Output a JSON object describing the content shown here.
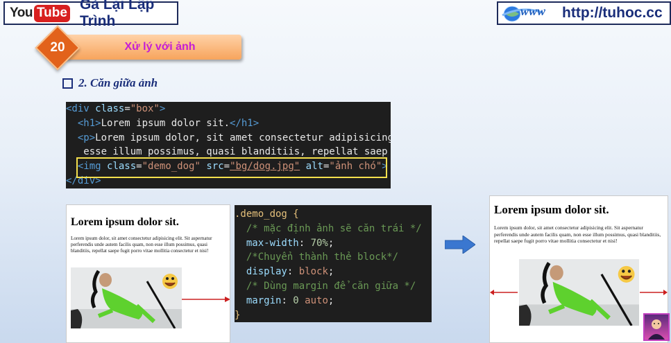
{
  "header": {
    "youtube_logo_you": "You",
    "youtube_logo_tube": "Tube",
    "channel_name": "Gà Lại Lập Trình",
    "globe_logo_text": "www",
    "site_url": "http://tuhoc.cc"
  },
  "lesson": {
    "number": "20",
    "title": "Xử lý với ảnh"
  },
  "section": {
    "heading": "2. Căn giữa ảnh"
  },
  "html_code": {
    "line1": {
      "open": "<div ",
      "attr": "class",
      "eq": "=",
      "val": "\"box\"",
      "close": ">"
    },
    "line2": {
      "indent": "  ",
      "open": "<h1>",
      "text": "Lorem ipsum dolor sit.",
      "close": "</h1>"
    },
    "line3": {
      "indent": "  ",
      "open": "<p>",
      "text": "Lorem ipsum dolor, sit amet consectetur adipisicing"
    },
    "line4": {
      "text": "   esse illum possimus, quasi blanditiis, repellat saep"
    },
    "line5": {
      "indent": "  ",
      "open": "<img ",
      "a1": "class",
      "v1": "\"demo_dog\"",
      "a2": "src",
      "v2": "\"bg/dog.jpg\"",
      "a3": "alt",
      "v3": "\"ảnh chó\"",
      "close": ">"
    },
    "line6": {
      "close": "</div>"
    }
  },
  "preview_left": {
    "heading": "Lorem ipsum dolor sit.",
    "paragraph": "Lorem ipsum dolor, sit amet consectetur adipisicing elit. Sit aspernatur perferendis unde autem facilis quam, non esse illum possimus, quasi blanditiis, repellat saepe fugit porro vitae mollitia consectetur et nisi!"
  },
  "css_code": {
    "selector": ".demo_dog",
    "open_brace": "{",
    "comment1": "/* mặc định ảnh sẽ căn trái */",
    "prop1": "max-width",
    "val1": "70%",
    "comment2": "/*Chuyển thành thẻ block*/",
    "prop2": "display",
    "val2": "block",
    "comment3": "/* Dùng margin để căn giữa */",
    "prop3": "margin",
    "val3a": "0",
    "val3b": "auto",
    "close_brace": "}"
  },
  "preview_right": {
    "heading": "Lorem ipsum dolor sit.",
    "paragraph": "Lorem ipsum dolor, sit amet consectetur adipisicing elit. Sit aspernatur perferendis unde autem facilis quam, non esse illum possimus, quasi blanditiis, repellat saepe fugit porro vitae mollitia consectetur et nisi!"
  },
  "colors": {
    "brand_blue": "#1a2e7a",
    "lesson_orange": "#e2621b",
    "lesson_title_magenta": "#c41dd6",
    "highlight_yellow": "#f4e04d",
    "arrow_red": "#cc2020",
    "arrow_blue": "#3a77d0"
  },
  "avatar": {
    "label": "Gà Lại Lập Trình"
  }
}
